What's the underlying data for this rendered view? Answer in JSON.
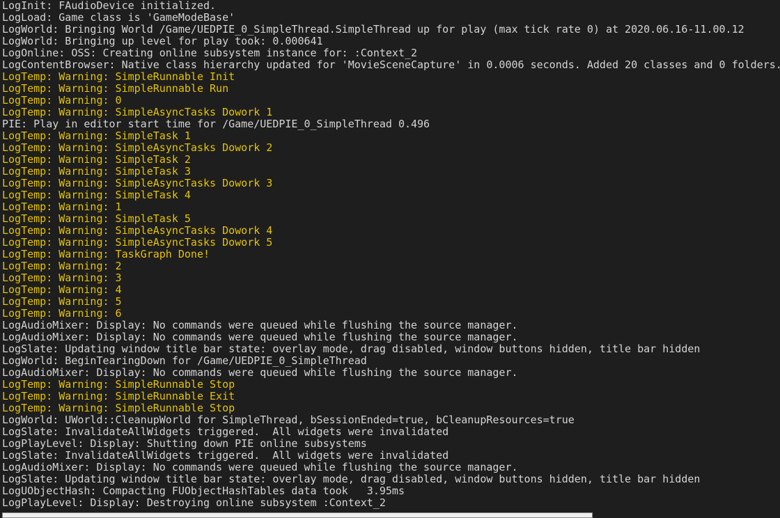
{
  "colors": {
    "background": "#1e1e1e",
    "text": "#d4d4d4",
    "warning": "#e5c400"
  },
  "lines": [
    {
      "text": "LogInit: FAudioDevice initialized.",
      "warning": false
    },
    {
      "text": "LogLoad: Game class is 'GameModeBase'",
      "warning": false
    },
    {
      "text": "LogWorld: Bringing World /Game/UEDPIE_0_SimpleThread.SimpleThread up for play (max tick rate 0) at 2020.06.16-11.00.12",
      "warning": false
    },
    {
      "text": "LogWorld: Bringing up level for play took: 0.000641",
      "warning": false
    },
    {
      "text": "LogOnline: OSS: Creating online subsystem instance for: :Context_2",
      "warning": false
    },
    {
      "text": "LogContentBrowser: Native class hierarchy updated for 'MovieSceneCapture' in 0.0006 seconds. Added 20 classes and 0 folders.",
      "warning": false
    },
    {
      "text": "LogTemp: Warning: SimpleRunnable Init",
      "warning": true
    },
    {
      "text": "LogTemp: Warning: SimpleRunnable Run",
      "warning": true
    },
    {
      "text": "LogTemp: Warning: 0",
      "warning": true
    },
    {
      "text": "LogTemp: Warning: SimpleAsyncTasks Dowork 1",
      "warning": true
    },
    {
      "text": "PIE: Play in editor start time for /Game/UEDPIE_0_SimpleThread 0.496",
      "warning": false
    },
    {
      "text": "LogTemp: Warning: SimpleTask 1",
      "warning": true
    },
    {
      "text": "LogTemp: Warning: SimpleAsyncTasks Dowork 2",
      "warning": true
    },
    {
      "text": "LogTemp: Warning: SimpleTask 2",
      "warning": true
    },
    {
      "text": "LogTemp: Warning: SimpleTask 3",
      "warning": true
    },
    {
      "text": "LogTemp: Warning: SimpleAsyncTasks Dowork 3",
      "warning": true
    },
    {
      "text": "LogTemp: Warning: SimpleTask 4",
      "warning": true
    },
    {
      "text": "LogTemp: Warning: 1",
      "warning": true
    },
    {
      "text": "LogTemp: Warning: SimpleTask 5",
      "warning": true
    },
    {
      "text": "LogTemp: Warning: SimpleAsyncTasks Dowork 4",
      "warning": true
    },
    {
      "text": "LogTemp: Warning: SimpleAsyncTasks Dowork 5",
      "warning": true
    },
    {
      "text": "LogTemp: Warning: TaskGraph Done!",
      "warning": true
    },
    {
      "text": "LogTemp: Warning: 2",
      "warning": true
    },
    {
      "text": "LogTemp: Warning: 3",
      "warning": true
    },
    {
      "text": "LogTemp: Warning: 4",
      "warning": true
    },
    {
      "text": "LogTemp: Warning: 5",
      "warning": true
    },
    {
      "text": "LogTemp: Warning: 6",
      "warning": true
    },
    {
      "text": "LogAudioMixer: Display: No commands were queued while flushing the source manager.",
      "warning": false
    },
    {
      "text": "LogAudioMixer: Display: No commands were queued while flushing the source manager.",
      "warning": false
    },
    {
      "text": "LogSlate: Updating window title bar state: overlay mode, drag disabled, window buttons hidden, title bar hidden",
      "warning": false
    },
    {
      "text": "LogWorld: BeginTearingDown for /Game/UEDPIE_0_SimpleThread",
      "warning": false
    },
    {
      "text": "LogAudioMixer: Display: No commands were queued while flushing the source manager.",
      "warning": false
    },
    {
      "text": "LogTemp: Warning: SimpleRunnable Stop",
      "warning": true
    },
    {
      "text": "LogTemp: Warning: SimpleRunnable Exit",
      "warning": true
    },
    {
      "text": "LogTemp: Warning: SimpleRunnable Stop",
      "warning": true
    },
    {
      "text": "LogWorld: UWorld::CleanupWorld for SimpleThread, bSessionEnded=true, bCleanupResources=true",
      "warning": false
    },
    {
      "text": "LogSlate: InvalidateAllWidgets triggered.  All widgets were invalidated",
      "warning": false
    },
    {
      "text": "LogPlayLevel: Display: Shutting down PIE online subsystems",
      "warning": false
    },
    {
      "text": "LogSlate: InvalidateAllWidgets triggered.  All widgets were invalidated",
      "warning": false
    },
    {
      "text": "LogAudioMixer: Display: No commands were queued while flushing the source manager.",
      "warning": false
    },
    {
      "text": "LogSlate: Updating window title bar state: overlay mode, drag disabled, window buttons hidden, title bar hidden",
      "warning": false
    },
    {
      "text": "LogUObjectHash: Compacting FUObjectHashTables data took   3.95ms",
      "warning": false
    },
    {
      "text": "LogPlayLevel: Display: Destroying online subsystem :Context_2",
      "warning": false
    }
  ]
}
